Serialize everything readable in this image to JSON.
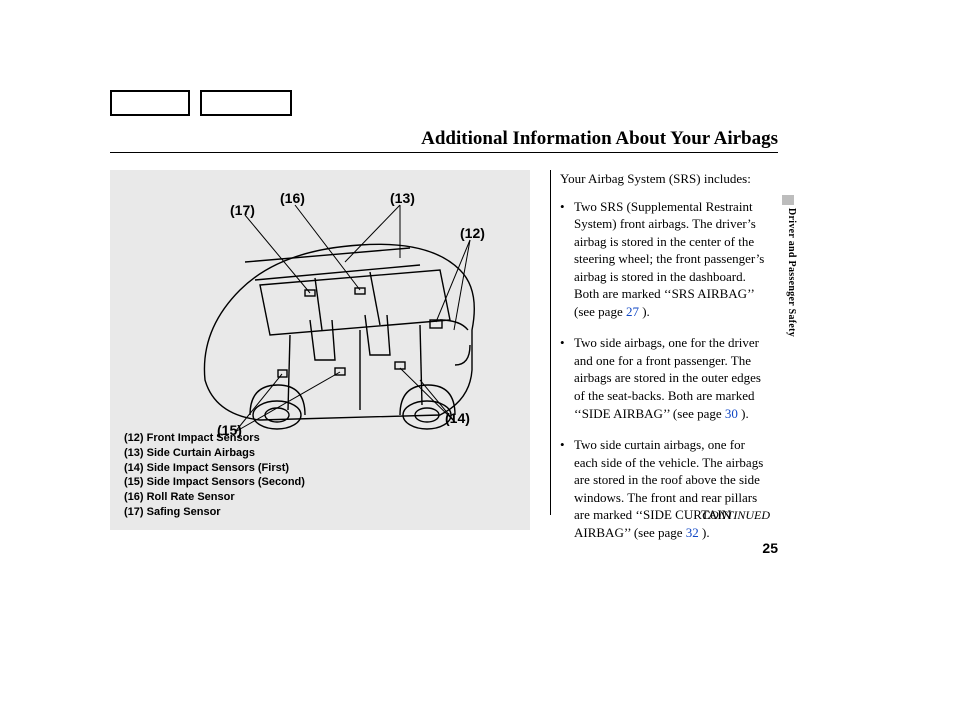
{
  "title": "Additional Information About Your Airbags",
  "side_label": "Driver and Passenger Safety",
  "continued": "CONTINUED",
  "page_number": "25",
  "callouts": {
    "c12": "(12)",
    "c13": "(13)",
    "c14": "(14)",
    "c15": "(15)",
    "c16": "(16)",
    "c17": "(17)"
  },
  "legend": {
    "l12": "(12) Front Impact Sensors",
    "l13": "(13) Side Curtain Airbags",
    "l14": "(14) Side Impact Sensors (First)",
    "l15": "(15) Side Impact Sensors (Second)",
    "l16": "(16) Roll Rate Sensor",
    "l17": "(17) Safing Sensor"
  },
  "text": {
    "intro": "Your Airbag System (SRS) includes:",
    "b1_a": "Two SRS (Supplemental Restraint System) front airbags. The driver’s airbag is stored in the center of the steering wheel; the front passenger’s airbag is stored in the dashboard. Both are marked ‘‘SRS AIRBAG’’ (see page ",
    "b1_ref": "27",
    "b1_b": " ).",
    "b2_a": "Two side airbags, one for the driver and one for a front passenger. The airbags are stored in the outer edges of the seat-backs. Both are marked ‘‘SIDE AIRBAG’’ (see page ",
    "b2_ref": "30",
    "b2_b": " ).",
    "b3_a": "Two side curtain airbags, one for each side of the vehicle. The airbags are stored in the roof above the side windows. The front and rear pillars are marked ‘‘SIDE CURTAIN AIRBAG’’ (see page ",
    "b3_ref": "32",
    "b3_b": " )."
  }
}
